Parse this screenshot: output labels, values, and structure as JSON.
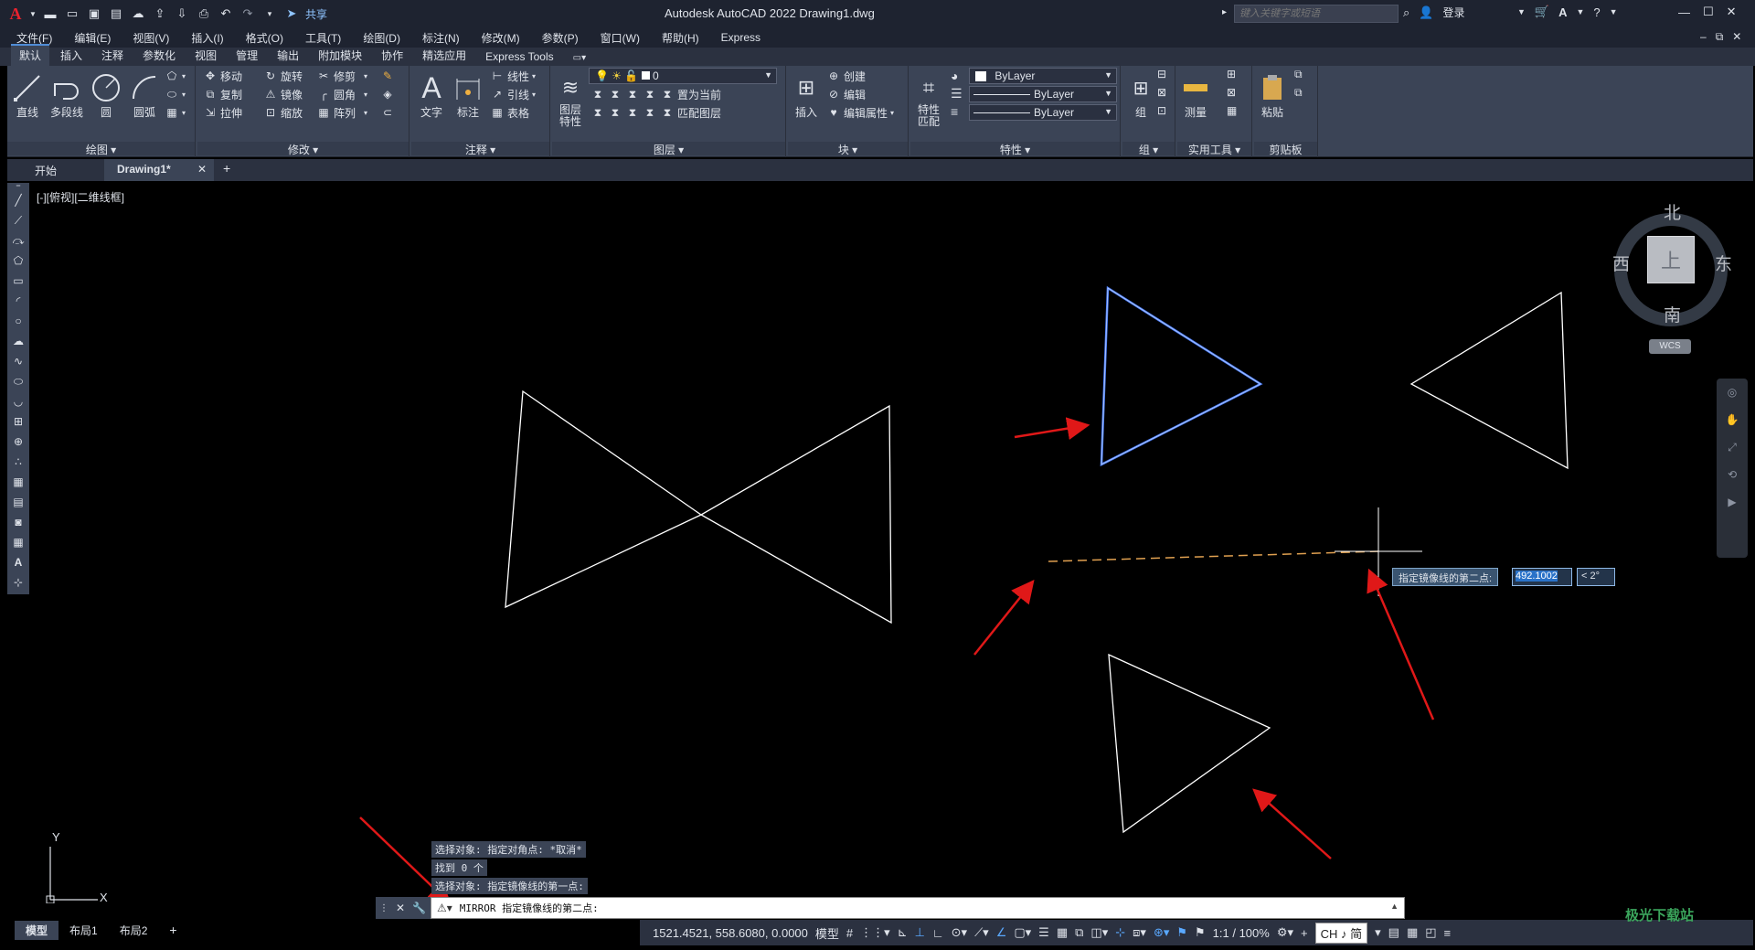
{
  "titlebar": {
    "share": "共享",
    "title": "Autodesk AutoCAD 2022    Drawing1.dwg",
    "search_placeholder": "键入关键字或短语",
    "login": "登录"
  },
  "menubar": [
    "文件(F)",
    "编辑(E)",
    "视图(V)",
    "插入(I)",
    "格式(O)",
    "工具(T)",
    "绘图(D)",
    "标注(N)",
    "修改(M)",
    "参数(P)",
    "窗口(W)",
    "帮助(H)",
    "Express"
  ],
  "ribbon_tabs": [
    "默认",
    "插入",
    "注释",
    "参数化",
    "视图",
    "管理",
    "输出",
    "附加模块",
    "协作",
    "精选应用",
    "Express Tools"
  ],
  "ribbon": {
    "draw": {
      "title": "绘图",
      "line": "直线",
      "polyline": "多段线",
      "circle": "圆",
      "arc": "圆弧"
    },
    "modify": {
      "title": "修改",
      "move": "移动",
      "rotate": "旋转",
      "trim": "修剪",
      "copy": "复制",
      "mirror": "镜像",
      "fillet": "圆角",
      "stretch": "拉伸",
      "scale": "缩放",
      "array": "阵列"
    },
    "annotation": {
      "title": "注释",
      "text": "文字",
      "dimension": "标注",
      "linear": "线性",
      "leader": "引线",
      "table": "表格"
    },
    "layers": {
      "title": "图层",
      "layer_props": "图层\n特性",
      "layer_name": "0",
      "set_current": "置为当前",
      "match_layer": "匹配图层"
    },
    "block": {
      "title": "块",
      "insert": "插入",
      "create": "创建",
      "edit": "编辑",
      "edit_attr": "编辑属性"
    },
    "properties": {
      "title": "特性",
      "match": "特性\n匹配",
      "color": "ByLayer",
      "linetype": "ByLayer",
      "lineweight": "ByLayer"
    },
    "groups": {
      "title": "组",
      "group": "组"
    },
    "utilities": {
      "title": "实用工具",
      "measure": "测量"
    },
    "clipboard": {
      "title": "剪贴板",
      "paste": "粘贴"
    }
  },
  "file_tabs": {
    "start": "开始",
    "drawing": "Drawing1*"
  },
  "viewport_label": "[-][俯视][二维线框]",
  "viewcube": {
    "north": "北",
    "south": "南",
    "east": "东",
    "west": "西",
    "face": "上",
    "wcs": "WCS"
  },
  "dynamic_input": {
    "prompt": "指定镜像线的第二点:",
    "value": "492.1002",
    "angle": "< 2°"
  },
  "command_history": [
    "选择对象: 指定对角点: *取消*",
    "找到 0 个",
    "选择对象:  指定镜像线的第一点:"
  ],
  "command_line": "MIRROR 指定镜像线的第二点:",
  "layout_tabs": [
    "模型",
    "布局1",
    "布局2"
  ],
  "status": {
    "coords": "1521.4521, 558.6080, 0.0000",
    "model": "模型",
    "scale": "1:1 / 100%",
    "ime": "CH ♪ 简"
  },
  "ucs": {
    "x": "X",
    "y": "Y"
  },
  "watermark": "极光下载站",
  "colors": {
    "selected": "#4a7fff",
    "arrow": "#e01818",
    "mirror_line": "#e0a050",
    "geometry": "#ffffff"
  }
}
